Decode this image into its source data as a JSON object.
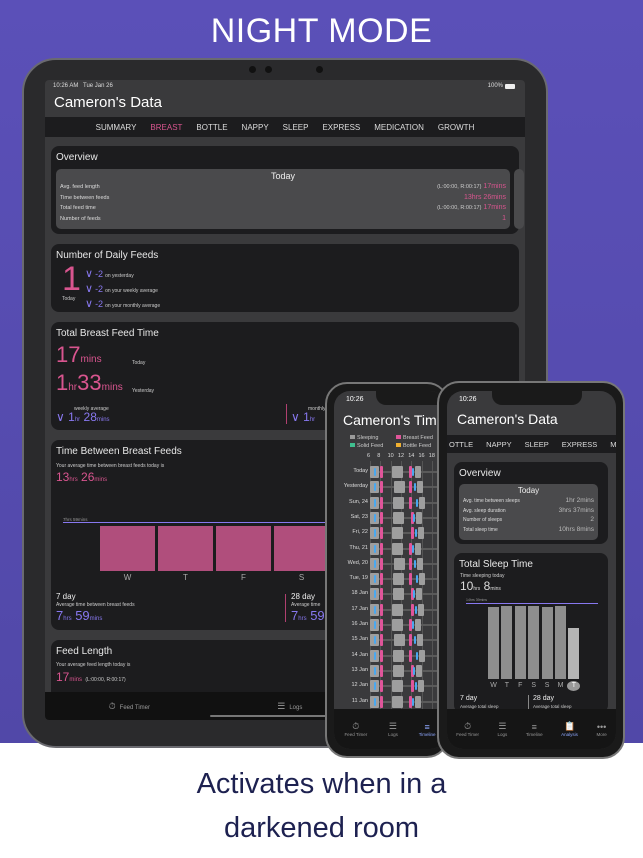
{
  "headline": "NIGHT MODE",
  "caption": [
    "Activates when in a",
    "darkened room"
  ],
  "ipad": {
    "status": {
      "time": "10:26 AM",
      "date": "Tue Jan 26",
      "battery": "100%"
    },
    "title": "Cameron's Data",
    "tabs": [
      "SUMMARY",
      "BREAST",
      "BOTTLE",
      "NAPPY",
      "SLEEP",
      "EXPRESS",
      "MEDICATION",
      "GROWTH"
    ],
    "active_tab": "BREAST",
    "overview": {
      "title": "Overview",
      "period": "Today",
      "rows": [
        {
          "label": "Avg. feed length",
          "detail": "(L:00:00, R:00:17)",
          "value": "17mins"
        },
        {
          "label": "Time between feeds",
          "detail": "",
          "value": "13hrs 26mins"
        },
        {
          "label": "Total feed time",
          "detail": "(L:00:00, R:00:17)",
          "value": "17mins"
        },
        {
          "label": "Number of feeds",
          "detail": "",
          "value": "1"
        }
      ]
    },
    "daily_feeds": {
      "title": "Number of Daily Feeds",
      "count": "1",
      "count_label": "Today",
      "comparisons": [
        {
          "value": "-2",
          "label": "on yesterday"
        },
        {
          "value": "-2",
          "label": "on your weekly average"
        },
        {
          "value": "-2",
          "label": "on your monthly average"
        }
      ]
    },
    "total_breast": {
      "title": "Total Breast Feed Time",
      "today_num": "17",
      "today_unit": "mins",
      "today_label": "Today",
      "yest_h": "1",
      "yest_h_unit": "hr",
      "yest_m": "33",
      "yest_m_unit": "mins",
      "yest_label": "Yesterday",
      "weekly_label": "weekly average",
      "weekly_h": "1",
      "weekly_m": "28",
      "monthly_label": "monthly average",
      "monthly_h": "1",
      "hr_unit": "hr",
      "mins_unit": "mins"
    },
    "time_between": {
      "title": "Time Between Breast Feeds",
      "subtitle": "Your average time between breast feeds today is",
      "today_h": "13",
      "today_m": "26",
      "hrs_unit": "hrs",
      "mins_unit": "mins",
      "avg_line_label": "7hrs 59mins",
      "chart_data": {
        "type": "bar",
        "categories": [
          "W",
          "T",
          "F",
          "S"
        ],
        "values": [
          7.98,
          7.98,
          7.98,
          7.98
        ],
        "ylim": [
          0,
          8.5
        ]
      },
      "day7": {
        "title": "7 day",
        "label": "Average time between breast feeds",
        "h": "7",
        "m": "59"
      },
      "day28": {
        "title": "28 day",
        "label": "Average time",
        "h": "7",
        "m": "59"
      }
    },
    "feed_length": {
      "title": "Feed Length",
      "subtitle": "Your average feed length today is",
      "value": "17",
      "unit": "mins",
      "detail": "(L:00:00, R:00:17)"
    },
    "tabbar": [
      "Feed Timer",
      "Logs",
      "Timeline"
    ]
  },
  "phone_timeline": {
    "time": "10:26",
    "title": "Cameron's Timeline",
    "legend": [
      {
        "label": "Sleeping",
        "color": "#9a9a9a"
      },
      {
        "label": "Breast Feed",
        "color": "#e0559a"
      },
      {
        "label": "Solid Feed",
        "color": "#3fbf8f"
      },
      {
        "label": "Bottle Feed",
        "color": "#f0b030"
      }
    ],
    "hours": [
      "6",
      "8",
      "10",
      "12",
      "14",
      "16",
      "18"
    ],
    "rows": [
      "Today",
      "Yesterday",
      "Sun, 24",
      "Sat, 23",
      "Fri, 22",
      "Thu, 21",
      "Wed, 20",
      "Tue, 19",
      "18 Jan",
      "17 Jan",
      "16 Jan",
      "15 Jan",
      "14 Jan",
      "13 Jan",
      "12 Jan",
      "11 Jan"
    ],
    "tabbar": [
      "Feed Timer",
      "Logs",
      "Timeline"
    ],
    "active_tab": "Timeline"
  },
  "phone_sleep": {
    "time": "10:26",
    "title": "Cameron's Data",
    "tabs": [
      "OTTLE",
      "NAPPY",
      "SLEEP",
      "EXPRESS",
      "MED"
    ],
    "active_tab": "Analysis",
    "overview": {
      "title": "Overview",
      "period": "Today",
      "rows": [
        {
          "label": "Avg. time between sleeps",
          "value": "1hr 2mins"
        },
        {
          "label": "Avg. sleep duration",
          "value": "3hrs 37mins"
        },
        {
          "label": "Number of sleeps",
          "value": "2"
        },
        {
          "label": "Total sleep time",
          "value": "10hrs 8mins"
        }
      ]
    },
    "total_sleep": {
      "title": "Total Sleep Time",
      "subtitle": "Time sleeping today",
      "h": "10",
      "m": "8",
      "hrs_unit": "hrs",
      "mins_unit": "mins",
      "avg_line_label": "14hrs 39mins",
      "chart_data": {
        "type": "bar",
        "categories": [
          "W",
          "T",
          "F",
          "S",
          "S",
          "M",
          "T"
        ],
        "values": [
          14.4,
          14.65,
          14.6,
          14.65,
          14.5,
          14.65,
          10.13
        ],
        "ylim": [
          0,
          15
        ],
        "highlight": "T"
      },
      "day7": {
        "title": "7 day",
        "label": "Average total sleep"
      },
      "day28": {
        "title": "28 day",
        "label": "Average total sleep"
      }
    },
    "tabbar": [
      "Feed Timer",
      "Logs",
      "Timeline",
      "Analysis",
      "More"
    ]
  },
  "colors": {
    "pink": "#d9558f",
    "purple": "#8878f0",
    "bg": "#5b50b8",
    "card": "#1c1c1e"
  }
}
